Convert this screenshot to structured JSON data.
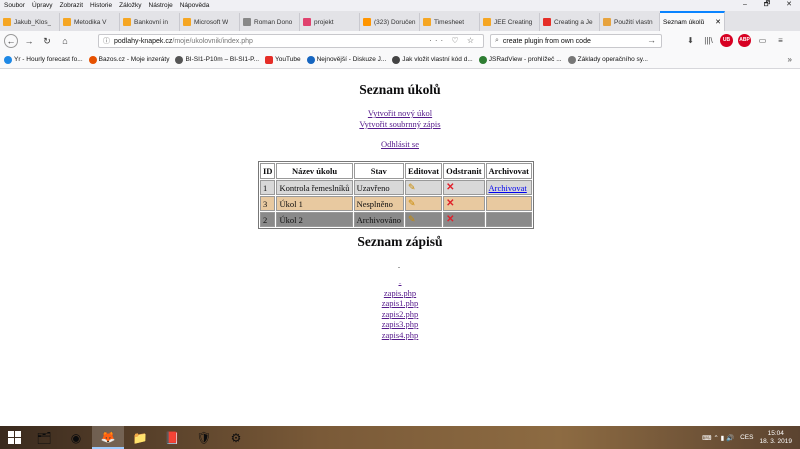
{
  "menubar": {
    "items": [
      "Soubor",
      "Úpravy",
      "Zobrazit",
      "Historie",
      "Záložky",
      "Nástroje",
      "Nápověda"
    ]
  },
  "window_controls": [
    "–",
    "🗗",
    "✕"
  ],
  "tabs": [
    {
      "label": "Jakub_Klos_",
      "color": "#f5a623"
    },
    {
      "label": "Metodika V",
      "color": "#f5a623"
    },
    {
      "label": "Bankovní in",
      "color": "#f5a623"
    },
    {
      "label": "Microsoft W",
      "color": "#f5a623"
    },
    {
      "label": "Roman Dono",
      "color": "#888888"
    },
    {
      "label": "projekt",
      "color": "#e0426e"
    },
    {
      "label": "(323) Doručení",
      "color": "#ff9500"
    },
    {
      "label": "Timesheet",
      "color": "#f5a623"
    },
    {
      "label": "JEE Creating",
      "color": "#f5a623"
    },
    {
      "label": "Creating a Je",
      "color": "#e52d27"
    },
    {
      "label": "Použití vlastn",
      "color": "#e7a33e"
    }
  ],
  "active_tab": {
    "label": "Seznam úkolů",
    "close": "✕"
  },
  "nav": {
    "url_host": "podlahy-knapek.cz",
    "url_path": "/moje/ukolovnik/index.php",
    "url_icons": "··· ♡ ☆",
    "search_value": "create plugin from own code",
    "search_go": "→"
  },
  "toolbar_icons": [
    "⬇",
    "|||\\",
    "UB",
    "ABP",
    "▭",
    "≡"
  ],
  "bookmarks": [
    {
      "label": "Yr - Hourly forecast fo...",
      "color": "#1e88e5"
    },
    {
      "label": "Bazos.cz - Moje inzeráty",
      "color": "#e65100"
    },
    {
      "label": "BI-SI1-P10m – BI-SI1-P...",
      "color": "#555555"
    },
    {
      "label": "YouTube",
      "color": "#e52d27"
    },
    {
      "label": "Nejnovější - Diskuze J...",
      "color": "#1565c0"
    },
    {
      "label": "Jak vložit vlastní kód d...",
      "color": "#444444"
    },
    {
      "label": "JSRadView - prohlížeč ...",
      "color": "#2e7d32"
    },
    {
      "label": "Základy operačního sy...",
      "color": "#777777"
    }
  ],
  "bookmarks_more": "»",
  "page": {
    "title": "Seznam úkolů",
    "link_new_task": "Vytvořit nový úkol",
    "link_new_file": "Vytvořit soubrnný zápis",
    "link_logout": "Odhlásit se",
    "table_headers": [
      "ID",
      "Název úkolu",
      "Stav",
      "Editovat",
      "Odstranit",
      "Archivovat"
    ],
    "rows": [
      {
        "id": "1",
        "name": "Kontrola řemeslníků",
        "state": "Uzavřeno",
        "archive": "Archivovat"
      },
      {
        "id": "3",
        "name": "Úkol 1",
        "state": "Nesplněno",
        "archive": ""
      },
      {
        "id": "2",
        "name": "Úkol 2",
        "state": "Archivováno",
        "archive": ""
      }
    ],
    "edit_glyph": "✎",
    "delete_glyph": "✕",
    "notes_title": "Seznam zápisů",
    "dot": ".",
    "notes_dots": "..",
    "notes": [
      "zapis.php",
      "zapis1.php",
      "zapis2.php",
      "zapis3.php",
      "zapis4.php"
    ]
  },
  "taskbar": {
    "apps": [
      "🗂",
      "◉",
      "🦊",
      "📁",
      "📕",
      "🛡",
      "⚙"
    ],
    "tray_icons": "⌨ ⌃ ▮ 🔊",
    "lang": "CES",
    "time": "15:04",
    "date": "18. 3. 2019"
  }
}
